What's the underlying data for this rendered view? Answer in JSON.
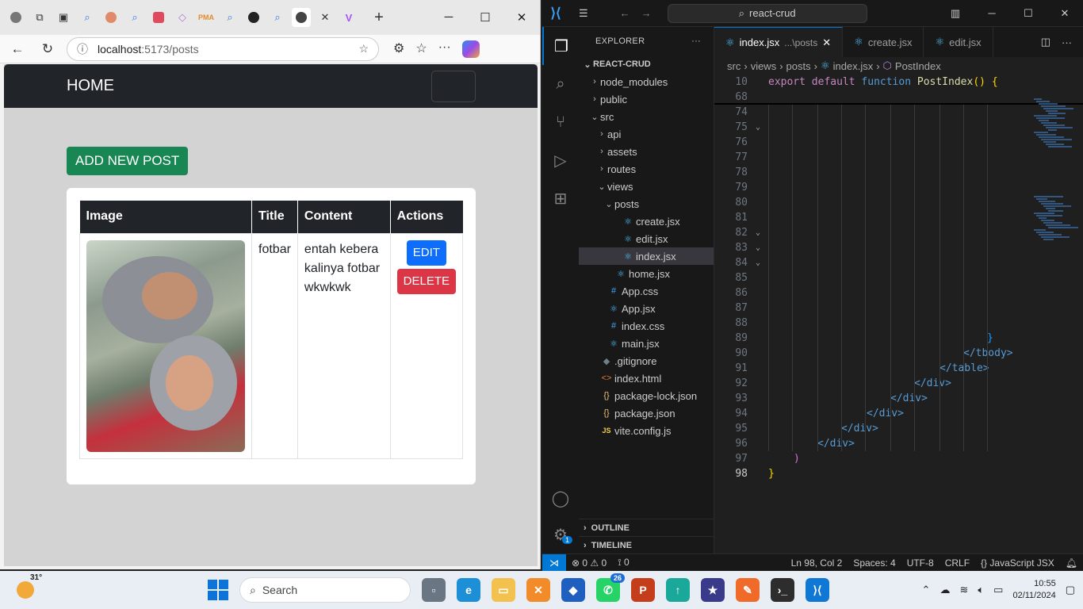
{
  "browser": {
    "tab_icons": [
      "profile",
      "workspaces",
      "tab-actions",
      "search",
      "chat",
      "search",
      "youtube",
      "diamond",
      "pma",
      "search",
      "github",
      "search",
      "copilot-tab",
      "close",
      "vite"
    ],
    "address": {
      "host": "localhost",
      "path": ":5173/posts"
    },
    "window_controls": {
      "minimize": "─",
      "maximize": "☐",
      "close": "✕"
    },
    "tab_close": "✕",
    "new_tab": "+"
  },
  "page": {
    "brand": "HOME",
    "add_button": "ADD NEW POST",
    "table": {
      "headers": [
        "Image",
        "Title",
        "Content",
        "Actions"
      ],
      "rows": [
        {
          "title": "fotbar",
          "content": "entah kebera kalinya fotbar wkwkwk",
          "edit": "EDIT",
          "delete": "DELETE"
        }
      ]
    }
  },
  "vscode": {
    "search": "react-crud",
    "explorer_label": "EXPLORER",
    "explorer_more": "···",
    "root": "REACT-CRUD",
    "tree": [
      {
        "label": "node_modules",
        "depth": 1,
        "kind": "folder",
        "open": false
      },
      {
        "label": "public",
        "depth": 1,
        "kind": "folder",
        "open": false
      },
      {
        "label": "src",
        "depth": 1,
        "kind": "folder",
        "open": true
      },
      {
        "label": "api",
        "depth": 2,
        "kind": "folder",
        "open": false
      },
      {
        "label": "assets",
        "depth": 2,
        "kind": "folder",
        "open": false
      },
      {
        "label": "routes",
        "depth": 2,
        "kind": "folder",
        "open": false
      },
      {
        "label": "views",
        "depth": 2,
        "kind": "folder",
        "open": true
      },
      {
        "label": "posts",
        "depth": 3,
        "kind": "folder",
        "open": true
      },
      {
        "label": "create.jsx",
        "depth": 4,
        "kind": "react"
      },
      {
        "label": "edit.jsx",
        "depth": 4,
        "kind": "react"
      },
      {
        "label": "index.jsx",
        "depth": 4,
        "kind": "react",
        "selected": true
      },
      {
        "label": "home.jsx",
        "depth": 3,
        "kind": "react"
      },
      {
        "label": "App.css",
        "depth": 2,
        "kind": "css"
      },
      {
        "label": "App.jsx",
        "depth": 2,
        "kind": "react"
      },
      {
        "label": "index.css",
        "depth": 2,
        "kind": "css"
      },
      {
        "label": "main.jsx",
        "depth": 2,
        "kind": "react"
      },
      {
        "label": ".gitignore",
        "depth": 1,
        "kind": "git"
      },
      {
        "label": "index.html",
        "depth": 1,
        "kind": "html"
      },
      {
        "label": "package-lock.json",
        "depth": 1,
        "kind": "json"
      },
      {
        "label": "package.json",
        "depth": 1,
        "kind": "json"
      },
      {
        "label": "vite.config.js",
        "depth": 1,
        "kind": "js"
      }
    ],
    "outline": "OUTLINE",
    "timeline": "TIMELINE",
    "tabs": [
      {
        "label": "index.jsx",
        "path": "...\\posts",
        "active": true
      },
      {
        "label": "create.jsx",
        "active": false
      },
      {
        "label": "edit.jsx",
        "active": false
      }
    ],
    "breadcrumb": [
      "src",
      "views",
      "posts",
      "index.jsx",
      "PostIndex"
    ],
    "sticky_lines": [
      {
        "num": "10",
        "text": "export default function PostIndex() {"
      },
      {
        "num": "68",
        "text": ""
      }
    ],
    "lines": [
      {
        "num": "74",
        "fold": "",
        "text": ""
      },
      {
        "num": "75",
        "fold": "v",
        "text": ""
      },
      {
        "num": "76",
        "fold": "",
        "text": ""
      },
      {
        "num": "77",
        "fold": "",
        "text": ""
      },
      {
        "num": "78",
        "fold": "",
        "text": ""
      },
      {
        "num": "79",
        "fold": "",
        "text": ""
      },
      {
        "num": "80",
        "fold": "",
        "text": ""
      },
      {
        "num": "81",
        "fold": "",
        "text": ""
      },
      {
        "num": "82",
        "fold": "v",
        "text": ""
      },
      {
        "num": "83",
        "fold": "v",
        "text": ""
      },
      {
        "num": "84",
        "fold": "v",
        "text": ""
      },
      {
        "num": "85",
        "fold": "",
        "text": ""
      },
      {
        "num": "86",
        "fold": "",
        "text": ""
      },
      {
        "num": "87",
        "fold": "",
        "text": ""
      },
      {
        "num": "88",
        "fold": "",
        "text": ""
      },
      {
        "num": "89",
        "fold": "",
        "text": "}"
      },
      {
        "num": "90",
        "fold": "",
        "text": "</tbody>"
      },
      {
        "num": "91",
        "fold": "",
        "text": "</table>"
      },
      {
        "num": "92",
        "fold": "",
        "text": "</div>"
      },
      {
        "num": "93",
        "fold": "",
        "text": "</div>"
      },
      {
        "num": "94",
        "fold": "",
        "text": "</div>"
      },
      {
        "num": "95",
        "fold": "",
        "text": "</div>"
      },
      {
        "num": "96",
        "fold": "",
        "text": "</div>"
      },
      {
        "num": "97",
        "fold": "",
        "text": ")"
      },
      {
        "num": "98",
        "fold": "",
        "text": "}"
      }
    ],
    "status": {
      "errors": "0",
      "warnings": "0",
      "ports": "0",
      "position": "Ln 98, Col 2",
      "spaces": "Spaces: 4",
      "encoding": "UTF-8",
      "eol": "CRLF",
      "language": "JavaScript JSX"
    },
    "settings_badge": "1"
  },
  "taskbar": {
    "temperature": "31°",
    "search_placeholder": "Search",
    "whatsapp_badge": "26",
    "time": "10:55",
    "date": "02/11/2024"
  }
}
